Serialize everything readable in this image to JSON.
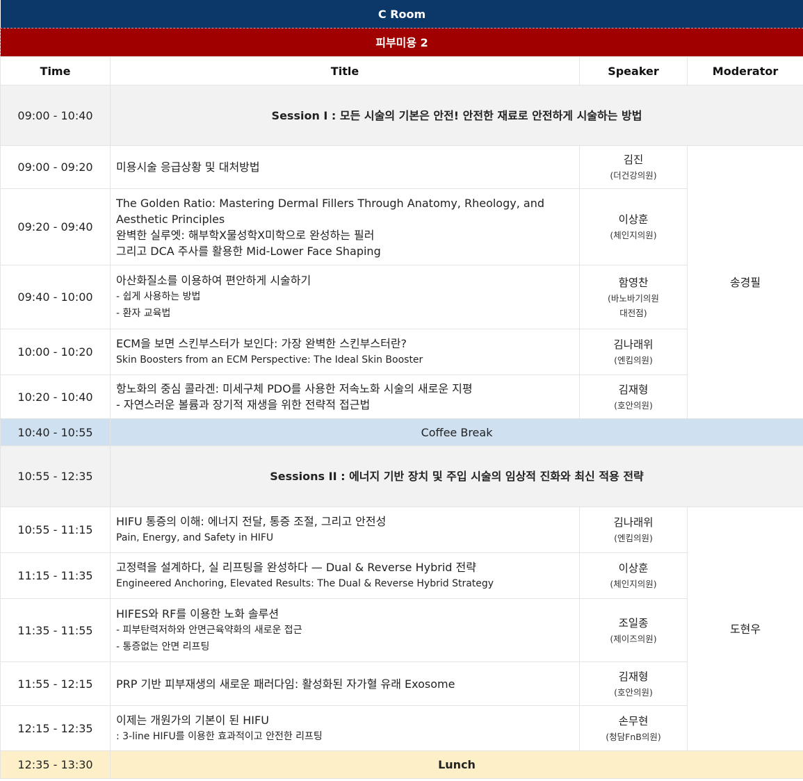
{
  "room": "C Room",
  "track": "피부미용 2",
  "headers": {
    "time": "Time",
    "title": "Title",
    "speaker": "Speaker",
    "moderator": "Moderator"
  },
  "session1": {
    "time": "09:00 - 10:40",
    "title": "Session I : 모든 시술의 기본은 안전! 안전한 재료로 안전하게 시술하는 방법"
  },
  "talks1": [
    {
      "time": "09:00 - 09:20",
      "lines": [
        "미용시술 응급상황 및 대처방법"
      ],
      "speaker": "김진",
      "affiliation": [
        "(더건강의원)"
      ]
    },
    {
      "time": "09:20 - 09:40",
      "lines": [
        "The Golden Ratio: Mastering Dermal Fillers Through Anatomy, Rheology, and",
        "Aesthetic Principles",
        "완벽한 실루엣: 해부학X물성학X미학으로 완성하는 필러",
        "그리고 DCA 주사를 활용한 Mid-Lower Face Shaping"
      ],
      "speaker": "이상훈",
      "affiliation": [
        "(체인지의원)"
      ]
    },
    {
      "time": "09:40 - 10:00",
      "lines": [
        "아산화질소를 이용하여 편안하게 시술하기",
        "- 쉽게 사용하는 방법",
        "- 환자 교육법"
      ],
      "speaker": "함영찬",
      "affiliation": [
        "(바노바기의원",
        "대전점)"
      ]
    },
    {
      "time": "10:00 - 10:20",
      "lines": [
        "ECM을 보면 스킨부스터가 보인다: 가장 완벽한 스킨부스터란?",
        "Skin Boosters from an ECM Perspective: The Ideal Skin Booster"
      ],
      "speaker": "김나래위",
      "affiliation": [
        "(엔킴의원)"
      ]
    },
    {
      "time": "10:20 - 10:40",
      "lines": [
        "항노화의 중심 콜라겐: 미세구체 PDO를 사용한 저속노화 시술의 새로운 지평",
        "- 자연스러운 볼륨과 장기적 재생을 위한 전략적 접근법"
      ],
      "speaker": "김재형",
      "affiliation": [
        "(호안의원)"
      ]
    }
  ],
  "moderator1": "송경필",
  "coffee": {
    "time": "10:40 - 10:55",
    "label": "Coffee Break"
  },
  "session2": {
    "time": "10:55 - 12:35",
    "title": "Sessions II :  에너지 기반 장치 및 주입 시술의 임상적 진화와 최신 적용 전략"
  },
  "talks2": [
    {
      "time": "10:55 - 11:15",
      "lines": [
        "HIFU 통증의 이해: 에너지 전달, 통증 조절, 그리고 안전성",
        "Pain, Energy, and Safety in HIFU"
      ],
      "speaker": "김나래위",
      "affiliation": [
        "(엔킴의원)"
      ]
    },
    {
      "time": "11:15 - 11:35",
      "lines": [
        "고정력을 설계하다, 실 리프팅을 완성하다 — Dual & Reverse Hybrid 전략",
        "Engineered Anchoring, Elevated Results: The Dual & Reverse Hybrid Strategy"
      ],
      "speaker": "이상훈",
      "affiliation": [
        "(체인지의원)"
      ]
    },
    {
      "time": "11:35 - 11:55",
      "lines": [
        "HIFES와 RF를 이용한 노화 솔루션",
        "- 피부탄력저하와 안면근육약화의 새로운 접근",
        "- 통증없는 안면 리프팅"
      ],
      "speaker": "조일종",
      "affiliation": [
        "(제이즈의원)"
      ]
    },
    {
      "time": "11:55 - 12:15",
      "lines": [
        "PRP 기반 피부재생의 새로운 패러다임: 활성화된 자가혈 유래 Exosome"
      ],
      "speaker": "김재형",
      "affiliation": [
        "(호안의원)"
      ]
    },
    {
      "time": "12:15 - 12:35",
      "lines": [
        "이제는 개원가의 기본이 된 HIFU",
        ": 3-line HIFU를 이용한 효과적이고 안전한 리프팅"
      ],
      "speaker": "손무현",
      "affiliation": [
        "(청담FnB의원)"
      ]
    }
  ],
  "moderator2": "도현우",
  "lunch": {
    "time": "12:35 - 13:30",
    "label": "Lunch"
  }
}
